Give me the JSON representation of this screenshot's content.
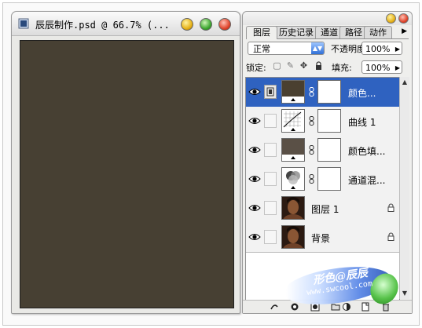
{
  "document": {
    "title": "辰辰制作.psd @ 66.7% (...",
    "canvas_color": "#474033"
  },
  "panel": {
    "tabs": [
      "图层",
      "历史记录",
      "通道",
      "路径",
      "动作"
    ],
    "active_tab": "图层",
    "blend_mode": "正常",
    "opacity_label": "不透明度:",
    "opacity_value": "100%",
    "lock_label": "锁定:",
    "fill_label": "填充:",
    "fill_value": "100%",
    "layers": [
      {
        "name": "颜色...",
        "thumb": "color-fill",
        "color": "#4a4030",
        "mask": true,
        "selected": true,
        "locked": false
      },
      {
        "name": "曲线 1",
        "thumb": "curves",
        "mask": true,
        "selected": false,
        "locked": false
      },
      {
        "name": "颜色填...",
        "thumb": "color-fill",
        "color": "#5a5046",
        "mask": true,
        "selected": false,
        "locked": false
      },
      {
        "name": "通道混...",
        "thumb": "channel-mixer",
        "mask": true,
        "selected": false,
        "locked": false
      },
      {
        "name": "图层 1",
        "thumb": "photo",
        "mask": false,
        "selected": false,
        "locked": true
      },
      {
        "name": "背景",
        "thumb": "photo",
        "mask": false,
        "selected": false,
        "locked": true
      }
    ],
    "bottom_icons": [
      "link-layers-icon",
      "layer-style-icon",
      "add-mask-icon",
      "new-group-icon",
      "adjustment-layer-icon",
      "new-layer-icon",
      "trash-icon"
    ]
  },
  "watermark": {
    "line1": "形色@辰辰",
    "line2": "www.swcool.com"
  },
  "colors": {
    "selection": "#2f62c0",
    "canvas": "#474033"
  }
}
